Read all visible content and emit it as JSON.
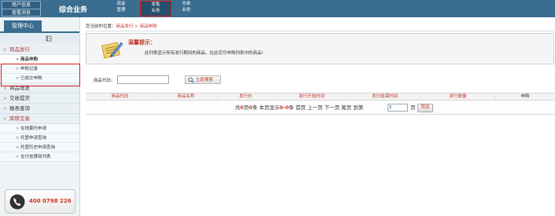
{
  "topbar": {
    "user_info": "用户信息",
    "view_messages": "查看消息",
    "biz_title": "综合业务",
    "nav": [
      {
        "line1": "资金",
        "line2": "管理"
      },
      {
        "line1": "发售",
        "line2": "业务"
      },
      {
        "line1": "仓单",
        "line2": "业务"
      }
    ]
  },
  "sidebar": {
    "tab": "管理中心",
    "menu": {
      "cat1": "商品发行",
      "cat1_subs": [
        "商品申购",
        "申购记录",
        "已成交申购"
      ],
      "cat2": "商品增发",
      "cat3": "交收提货",
      "cat4": "报表查询",
      "cat5": "库转交易",
      "cat5_subs": [
        "在线委托申请",
        "托管申请查询",
        "托管历史申请查询",
        "支付挂牌商列表"
      ]
    },
    "phone": "400 0798 226"
  },
  "main": {
    "crumb_prefix": "您当前的位置：",
    "crumb_path": "商品发行 > 商品申购",
    "tip_title": "温馨提示：",
    "tip_text": "此列表显示所有发行期间的商品。在此您可申购列表中的商品!",
    "search_label": "商品代码：",
    "search_value": "",
    "search_button": "立即搜索",
    "columns": [
      "商品代码",
      "商品名称",
      "发行价",
      "发行开始时间",
      "发行结束时间",
      "发行数量",
      "申购"
    ],
    "pager": {
      "t1": "共",
      "pages": "0",
      "t2": "页",
      "records": "0",
      "t3": "条 本页显示",
      "range": "0-0",
      "t4": "条 首页 上一页 下一页 尾页 到第",
      "page_input": "1",
      "t5": "页",
      "go": "转到"
    }
  }
}
